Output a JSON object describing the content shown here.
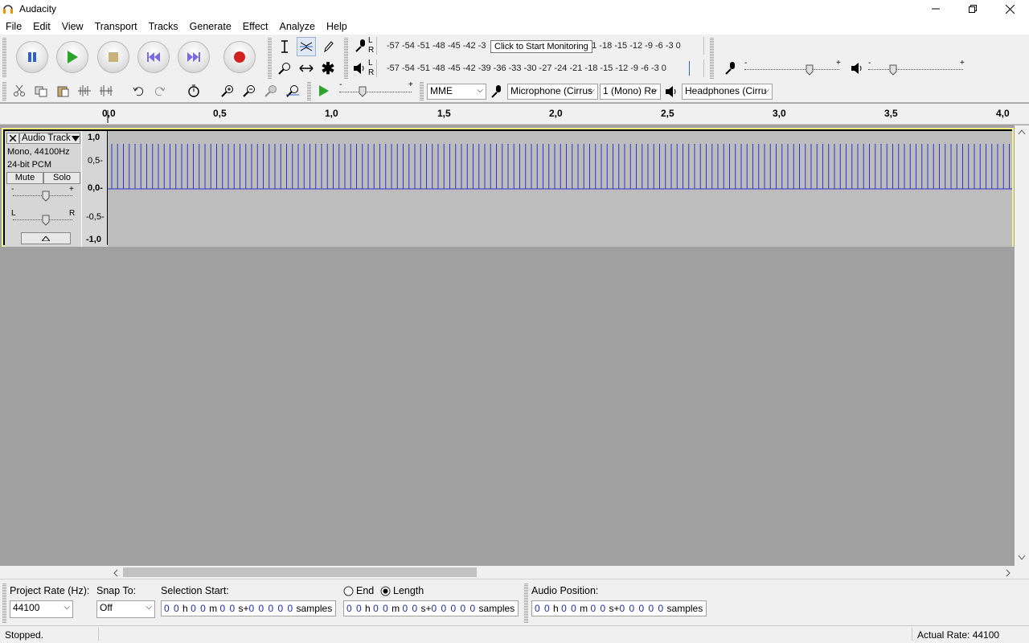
{
  "window": {
    "title": "Audacity"
  },
  "menu": [
    "File",
    "Edit",
    "View",
    "Transport",
    "Tracks",
    "Generate",
    "Effect",
    "Analyze",
    "Help"
  ],
  "meters": {
    "record_scale": "-57 -54 -51 -48 -45 -42 -3",
    "record_scale_tail": "21 -18 -15 -12  -9  -6  -3  0",
    "playback_scale": "-57 -54 -51 -48 -45 -42 -39 -36 -33 -30 -27 -24 -21 -18 -15 -12  -9  -6  -3  0",
    "tooltip": "Click to Start Monitoring",
    "lr_l": "L",
    "lr_r": "R",
    "slider_minus": "-",
    "slider_plus": "+"
  },
  "device": {
    "host": "MME",
    "input": "Microphone (Cirrus",
    "channels": "1 (Mono) Re",
    "output": "Headphones (Cirru"
  },
  "ruler": [
    "0,0",
    "0,5",
    "1,0",
    "1,5",
    "2,0",
    "2,5",
    "3,0",
    "3,5",
    "4,0"
  ],
  "track": {
    "name": "Audio Track",
    "info1": "Mono, 44100Hz",
    "info2": "24-bit PCM",
    "mute": "Mute",
    "solo": "Solo",
    "gain_minus": "-",
    "gain_plus": "+",
    "pan_l": "L",
    "pan_r": "R",
    "scale": [
      "1,0",
      "0,5-",
      "0,0-",
      "-0,5-",
      "-1,0"
    ]
  },
  "selection_bar": {
    "project_rate_label": "Project Rate (Hz):",
    "project_rate": "44100",
    "snap_label": "Snap To:",
    "snap_value": "Off",
    "selection_start_label": "Selection Start:",
    "end_label": "End",
    "length_label": "Length",
    "audio_position_label": "Audio Position:",
    "time_digits": {
      "h": "0 0",
      "m": "0 0",
      "s": "0 0",
      "samples": "0 0 0 0 0"
    },
    "units": {
      "h": "h",
      "m": "m",
      "s": "s+",
      "samples": "samples"
    }
  },
  "status": {
    "left": "Stopped.",
    "right": "Actual Rate: 44100"
  },
  "colors": {
    "waveform": "#3232c8",
    "play_green": "#2aa52a",
    "record_red": "#d32020"
  }
}
